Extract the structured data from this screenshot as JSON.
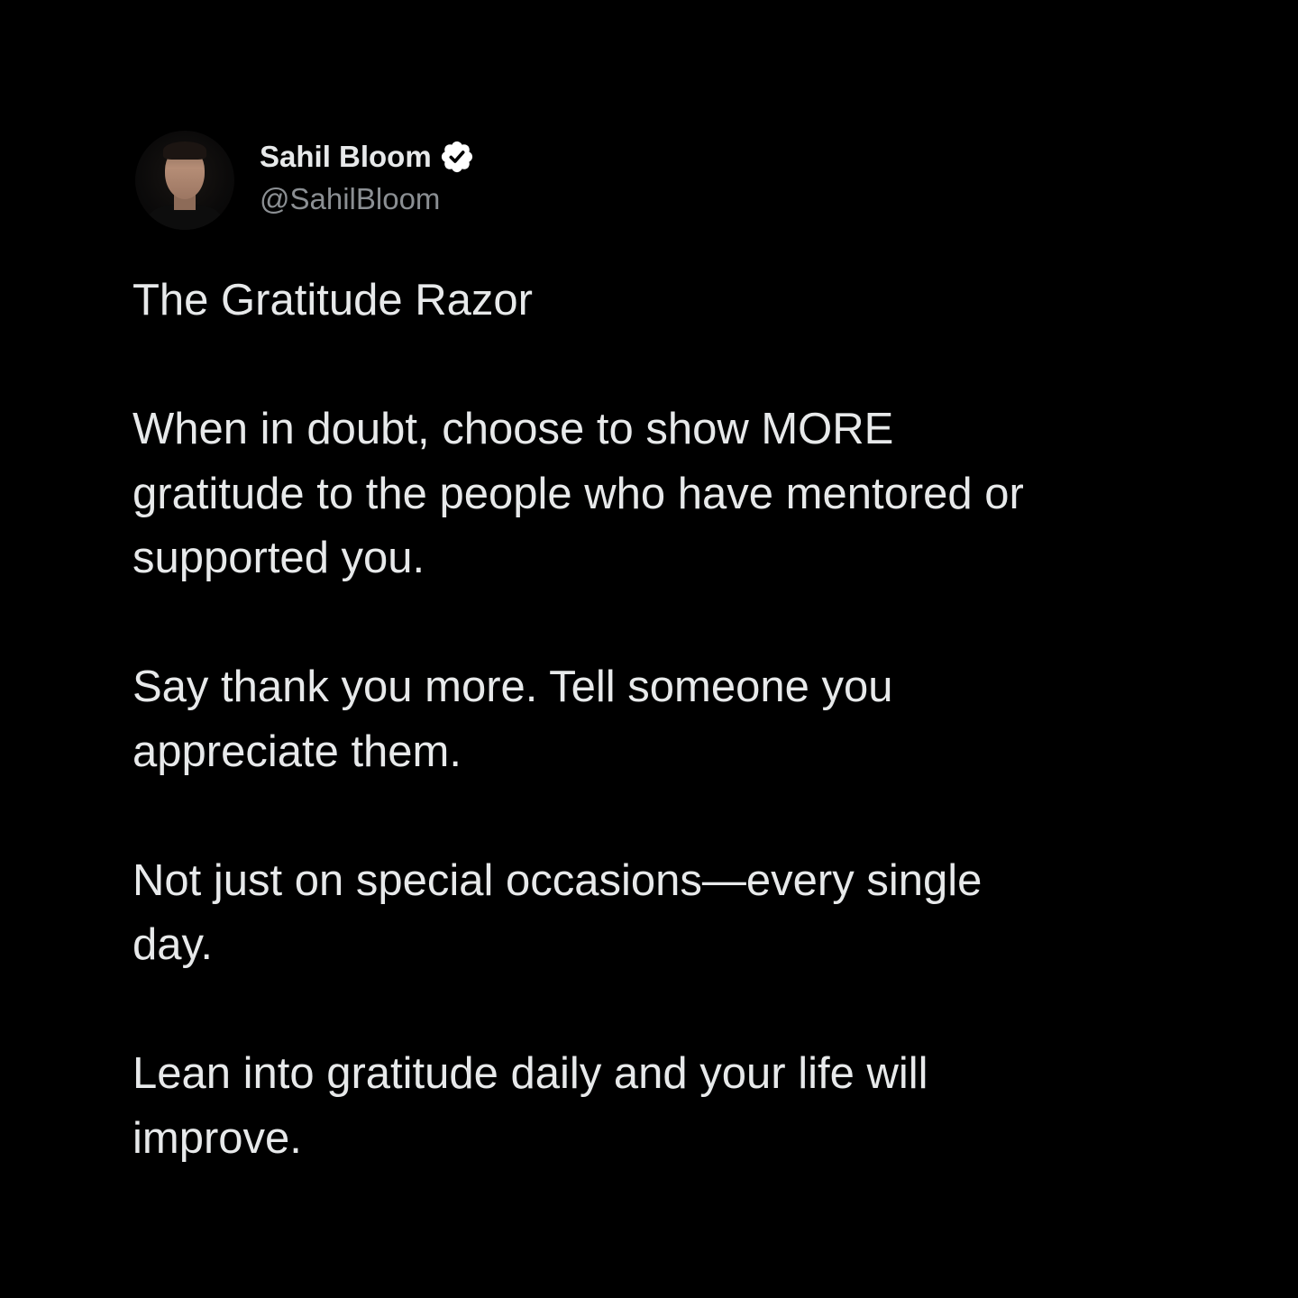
{
  "author": {
    "name": "Sahil Bloom",
    "handle": "@SahilBloom",
    "verified": true,
    "avatar_icon": "avatar-photo"
  },
  "tweet": {
    "lines": [
      "The Gratitude Razor",
      "",
      "When in doubt, choose to show MORE",
      "gratitude to the people who have mentored or",
      "supported you.",
      "",
      "Say thank you more. Tell someone you",
      "appreciate them.",
      "",
      "Not just on special occasions—every single",
      "day.",
      "",
      "Lean into gratitude daily and your life will",
      "improve."
    ]
  },
  "colors": {
    "background": "#000000",
    "text": "#e7e9ea",
    "handle": "#8b8f93"
  }
}
